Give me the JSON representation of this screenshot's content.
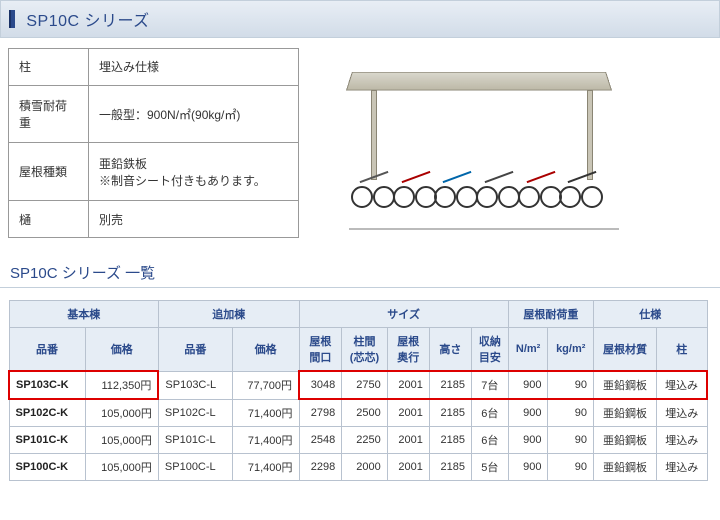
{
  "title": "SP10C シリーズ",
  "spec": {
    "rows": [
      {
        "label": "柱",
        "value": "埋込み仕様"
      },
      {
        "label": "積雪耐荷重",
        "value": "一般型：900N/㎡(90kg/㎡)"
      },
      {
        "label": "屋根種類",
        "value": "亜鉛鉄板\n※制音シート付きもあります。"
      },
      {
        "label": "樋",
        "value": "別売"
      }
    ]
  },
  "list_title": "SP10C シリーズ 一覧",
  "headers": {
    "group1": "基本棟",
    "group2": "追加棟",
    "group3": "サイズ",
    "group4": "屋根耐荷重",
    "group5": "仕様",
    "code": "品番",
    "price": "価格",
    "roof_w": "屋根\n間口",
    "pillar": "柱間\n(芯芯)",
    "roof_d": "屋根\n奥行",
    "height": "高さ",
    "capacity": "収納\n目安",
    "nm2": "N/m²",
    "kgm2": "kg/m²",
    "roof_mat": "屋根材質",
    "pillar_spec": "柱"
  },
  "rows": [
    {
      "code1": "SP103C-K",
      "price1": "112,350円",
      "code2": "SP103C-L",
      "price2": "77,700円",
      "roof_w": "3048",
      "pillar": "2750",
      "roof_d": "2001",
      "height": "2185",
      "cap": "7台",
      "nm2": "900",
      "kgm2": "90",
      "mat": "亜鉛鋼板",
      "ps": "埋込み",
      "hl": true
    },
    {
      "code1": "SP102C-K",
      "price1": "105,000円",
      "code2": "SP102C-L",
      "price2": "71,400円",
      "roof_w": "2798",
      "pillar": "2500",
      "roof_d": "2001",
      "height": "2185",
      "cap": "6台",
      "nm2": "900",
      "kgm2": "90",
      "mat": "亜鉛鋼板",
      "ps": "埋込み",
      "hl": false
    },
    {
      "code1": "SP101C-K",
      "price1": "105,000円",
      "code2": "SP101C-L",
      "price2": "71,400円",
      "roof_w": "2548",
      "pillar": "2250",
      "roof_d": "2001",
      "height": "2185",
      "cap": "6台",
      "nm2": "900",
      "kgm2": "90",
      "mat": "亜鉛鋼板",
      "ps": "埋込み",
      "hl": false
    },
    {
      "code1": "SP100C-K",
      "price1": "105,000円",
      "code2": "SP100C-L",
      "price2": "71,400円",
      "roof_w": "2298",
      "pillar": "2000",
      "roof_d": "2001",
      "height": "2185",
      "cap": "5台",
      "nm2": "900",
      "kgm2": "90",
      "mat": "亜鉛鋼板",
      "ps": "埋込み",
      "hl": false
    }
  ]
}
